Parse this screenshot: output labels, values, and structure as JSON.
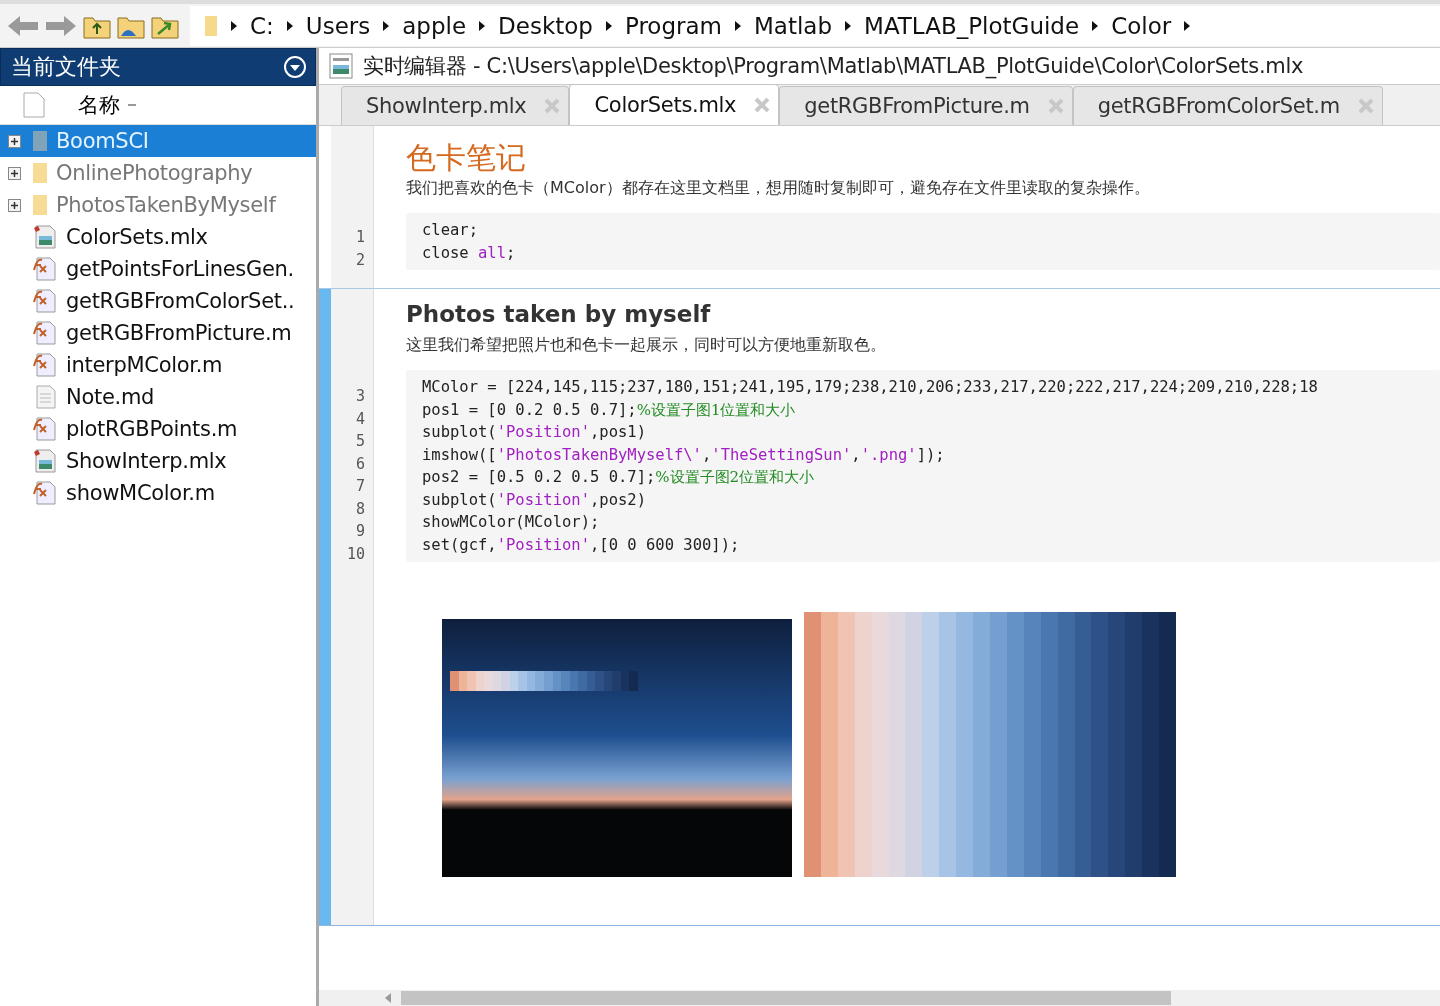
{
  "breadcrumb": [
    "C:",
    "Users",
    "apple",
    "Desktop",
    "Program",
    "Matlab",
    "MATLAB_PlotGuide",
    "Color"
  ],
  "file_panel": {
    "title": "当前文件夹",
    "column": "名称",
    "items": [
      {
        "name": "BoomSCI",
        "kind": "folder",
        "selected": true,
        "expanded": false
      },
      {
        "name": "OnlinePhotography",
        "kind": "folder",
        "selected": false,
        "expanded": false
      },
      {
        "name": "PhotosTakenByMyself",
        "kind": "folder",
        "selected": false,
        "expanded": false
      },
      {
        "name": "ColorSets.mlx",
        "kind": "live",
        "selected": false
      },
      {
        "name": "getPointsForLinesGen.",
        "kind": "function",
        "selected": false
      },
      {
        "name": "getRGBFromColorSet..",
        "kind": "function",
        "selected": false
      },
      {
        "name": "getRGBFromPicture.m",
        "kind": "function",
        "selected": false
      },
      {
        "name": "interpMColor.m",
        "kind": "function",
        "selected": false
      },
      {
        "name": "Note.md",
        "kind": "text",
        "selected": false
      },
      {
        "name": "plotRGBPoints.m",
        "kind": "function",
        "selected": false
      },
      {
        "name": "ShowInterp.mlx",
        "kind": "live",
        "selected": false
      },
      {
        "name": "showMColor.m",
        "kind": "function",
        "selected": false
      }
    ]
  },
  "editor": {
    "title": "实时编辑器 - C:\\Users\\apple\\Desktop\\Program\\Matlab\\MATLAB_PlotGuide\\Color\\ColorSets.mlx",
    "tabs": [
      {
        "label": "ShowInterp.mlx",
        "selected": false
      },
      {
        "label": "ColorSets.mlx",
        "selected": true
      },
      {
        "label": "getRGBFromPicture.m",
        "selected": false
      },
      {
        "label": "getRGBFromColorSet.m",
        "selected": false
      }
    ],
    "sections": [
      {
        "kind": "title",
        "heading": "色卡笔记",
        "active": false,
        "text": "我们把喜欢的色卡（MColor）都存在这里文档里，想用随时复制即可，避免存在文件里读取的复杂操作。",
        "code": [
          {
            "number": "1",
            "tokens": [
              {
                "kind": "plain",
                "text": "clear;"
              }
            ]
          },
          {
            "number": "2",
            "tokens": [
              {
                "kind": "plain",
                "text": "close "
              },
              {
                "kind": "string",
                "text": "all"
              },
              {
                "kind": "plain",
                "text": ";"
              }
            ]
          }
        ]
      },
      {
        "kind": "heading",
        "heading": "Photos taken by myself",
        "active": true,
        "text": "这里我们希望把照片也和色卡一起展示，同时可以方便地重新取色。",
        "code": [
          {
            "number": "3",
            "tokens": [
              {
                "kind": "plain",
                "text": "MColor = [224,145,115;237,180,151;241,195,179;238,210,206;233,217,220;222,217,224;209,210,228;18"
              }
            ]
          },
          {
            "number": "4",
            "tokens": [
              {
                "kind": "plain",
                "text": "pos1 = [0 0.2 0.5 0.7];"
              },
              {
                "kind": "comment",
                "text": "%设置子图1位置和大小"
              }
            ]
          },
          {
            "number": "5",
            "tokens": [
              {
                "kind": "plain",
                "text": "subplot("
              },
              {
                "kind": "string",
                "text": "'Position'"
              },
              {
                "kind": "plain",
                "text": ",pos1)"
              }
            ]
          },
          {
            "number": "6",
            "tokens": [
              {
                "kind": "plain",
                "text": "imshow(["
              },
              {
                "kind": "string",
                "text": "'PhotosTakenByMyself\\'"
              },
              {
                "kind": "plain",
                "text": ","
              },
              {
                "kind": "string",
                "text": "'TheSettingSun'"
              },
              {
                "kind": "plain",
                "text": ","
              },
              {
                "kind": "string",
                "text": "'.png'"
              },
              {
                "kind": "plain",
                "text": "]);"
              }
            ]
          },
          {
            "number": "7",
            "tokens": [
              {
                "kind": "plain",
                "text": "pos2 = [0.5 0.2 0.5 0.7];"
              },
              {
                "kind": "comment",
                "text": "%设置子图2位置和大小"
              }
            ]
          },
          {
            "number": "8",
            "tokens": [
              {
                "kind": "plain",
                "text": "subplot("
              },
              {
                "kind": "string",
                "text": "'Position'"
              },
              {
                "kind": "plain",
                "text": ",pos2)"
              }
            ]
          },
          {
            "number": "9",
            "tokens": [
              {
                "kind": "plain",
                "text": "showMColor(MColor);"
              }
            ]
          },
          {
            "number": "10",
            "tokens": [
              {
                "kind": "plain",
                "text": "set(gcf,"
              },
              {
                "kind": "string",
                "text": "'Position'"
              },
              {
                "kind": "plain",
                "text": ",[0 0 600 300]);"
              }
            ]
          }
        ],
        "output": {
          "swatches": [
            {
              "color": "#e09173"
            },
            {
              "color": "#edb497"
            },
            {
              "color": "#f1c3b3"
            },
            {
              "color": "#eed2ce"
            },
            {
              "color": "#e9d9dc"
            },
            {
              "color": "#ded9e0"
            },
            {
              "color": "#d1d2e4"
            },
            {
              "color": "#bdd0e9"
            },
            {
              "color": "#a7c4e6"
            },
            {
              "color": "#94b8e0"
            },
            {
              "color": "#84acd8"
            },
            {
              "color": "#749fd0"
            },
            {
              "color": "#6592c6"
            },
            {
              "color": "#5684bb"
            },
            {
              "color": "#4a77af"
            },
            {
              "color": "#3f6aa2"
            },
            {
              "color": "#365e95"
            },
            {
              "color": "#2e5287"
            },
            {
              "color": "#27477a"
            },
            {
              "color": "#203d6c"
            },
            {
              "color": "#1a335e"
            },
            {
              "color": "#142a50"
            }
          ]
        }
      }
    ]
  }
}
